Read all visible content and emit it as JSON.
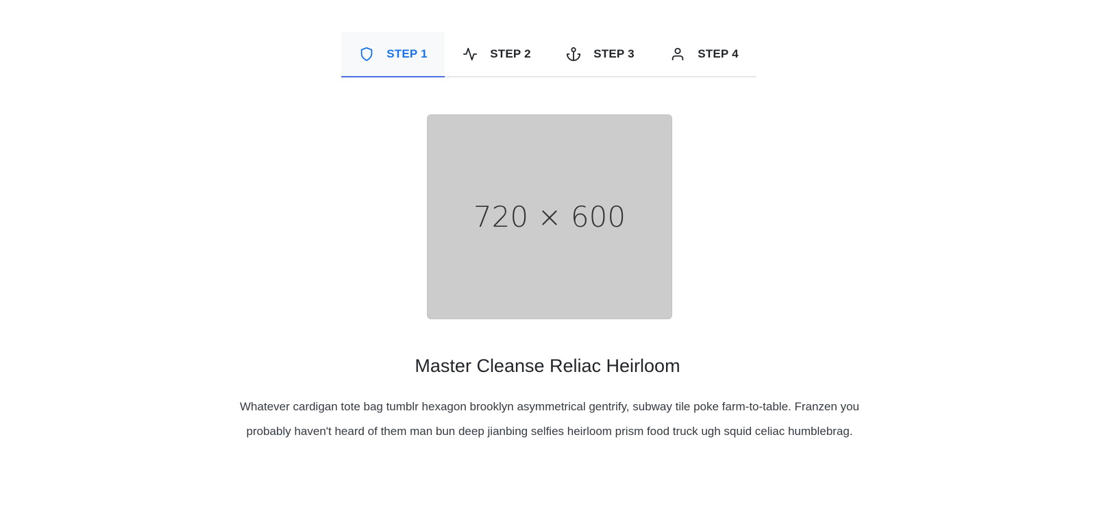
{
  "tabs": [
    {
      "label": "STEP 1",
      "icon": "shield-icon",
      "active": true
    },
    {
      "label": "STEP 2",
      "icon": "activity-icon",
      "active": false
    },
    {
      "label": "STEP 3",
      "icon": "anchor-icon",
      "active": false
    },
    {
      "label": "STEP 4",
      "icon": "user-icon",
      "active": false
    }
  ],
  "colors": {
    "accent": "#1a73e8",
    "underline": "#4c6fe0",
    "placeholder_bg": "#cccccc"
  },
  "content": {
    "image_placeholder_text": "720 × 600",
    "title": "Master Cleanse Reliac Heirloom",
    "description": "Whatever cardigan tote bag tumblr hexagon brooklyn asymmetrical gentrify, subway tile poke farm-to-table. Franzen you probably haven't heard of them man bun deep jianbing selfies heirloom prism food truck ugh squid celiac humblebrag."
  }
}
